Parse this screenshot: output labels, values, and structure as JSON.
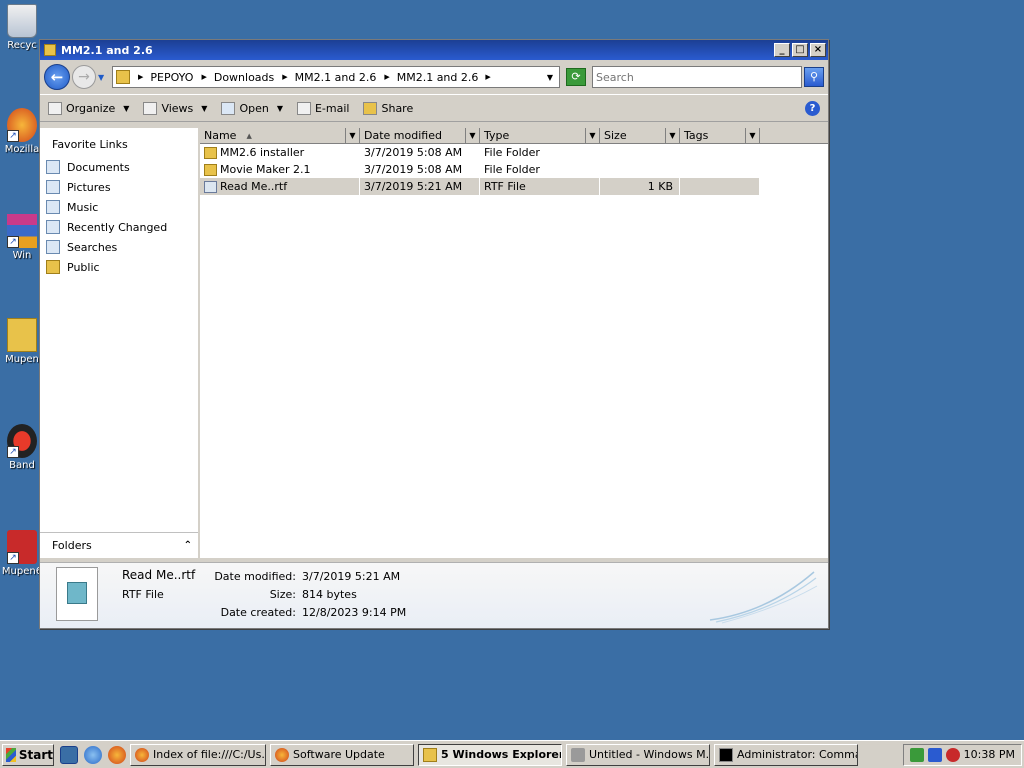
{
  "desktop": {
    "icons": [
      {
        "label": "Recyc",
        "name": "desktop-recycle-bin"
      },
      {
        "label": "Mozilla",
        "name": "desktop-mozilla"
      },
      {
        "label": "Win",
        "name": "desktop-win"
      },
      {
        "label": "Mupen",
        "name": "desktop-mupen-folder"
      },
      {
        "label": "Band",
        "name": "desktop-band"
      },
      {
        "label": "Mupen6",
        "name": "desktop-mupen64"
      }
    ]
  },
  "window": {
    "title": "MM2.1 and 2.6",
    "controls": {
      "minimize": "_",
      "maximize": "□",
      "close": "×"
    }
  },
  "address": {
    "crumbs": [
      "PEPOYO",
      "Downloads",
      "MM2.1 and 2.6",
      "MM2.1 and 2.6"
    ],
    "search_placeholder": "Search"
  },
  "toolbar": {
    "organize": "Organize",
    "views": "Views",
    "open": "Open",
    "email": "E-mail",
    "share": "Share"
  },
  "nav": {
    "header": "Favorite Links",
    "items": [
      "Documents",
      "Pictures",
      "Music",
      "Recently Changed",
      "Searches",
      "Public"
    ],
    "folders_label": "Folders"
  },
  "columns": [
    "Name",
    "Date modified",
    "Type",
    "Size",
    "Tags"
  ],
  "files": [
    {
      "name": "MM2.6 installer",
      "date": "3/7/2019 5:08 AM",
      "type": "File Folder",
      "size": "",
      "tags": ""
    },
    {
      "name": "Movie Maker 2.1",
      "date": "3/7/2019 5:08 AM",
      "type": "File Folder",
      "size": "",
      "tags": ""
    },
    {
      "name": "Read Me..rtf",
      "date": "3/7/2019 5:21 AM",
      "type": "RTF File",
      "size": "1 KB",
      "tags": ""
    }
  ],
  "details": {
    "name": "Read Me..rtf",
    "type": "RTF File",
    "date_modified_label": "Date modified:",
    "date_modified": "3/7/2019 5:21 AM",
    "size_label": "Size:",
    "size": "814 bytes",
    "date_created_label": "Date created:",
    "date_created": "12/8/2023 9:14 PM"
  },
  "taskbar": {
    "start": "Start",
    "tasks": [
      "Index of file:///C:/Us...",
      "Software Update",
      "5 Windows Explorer",
      "Untitled - Windows M...",
      "Administrator: Comma..."
    ],
    "clock": "10:38 PM"
  }
}
